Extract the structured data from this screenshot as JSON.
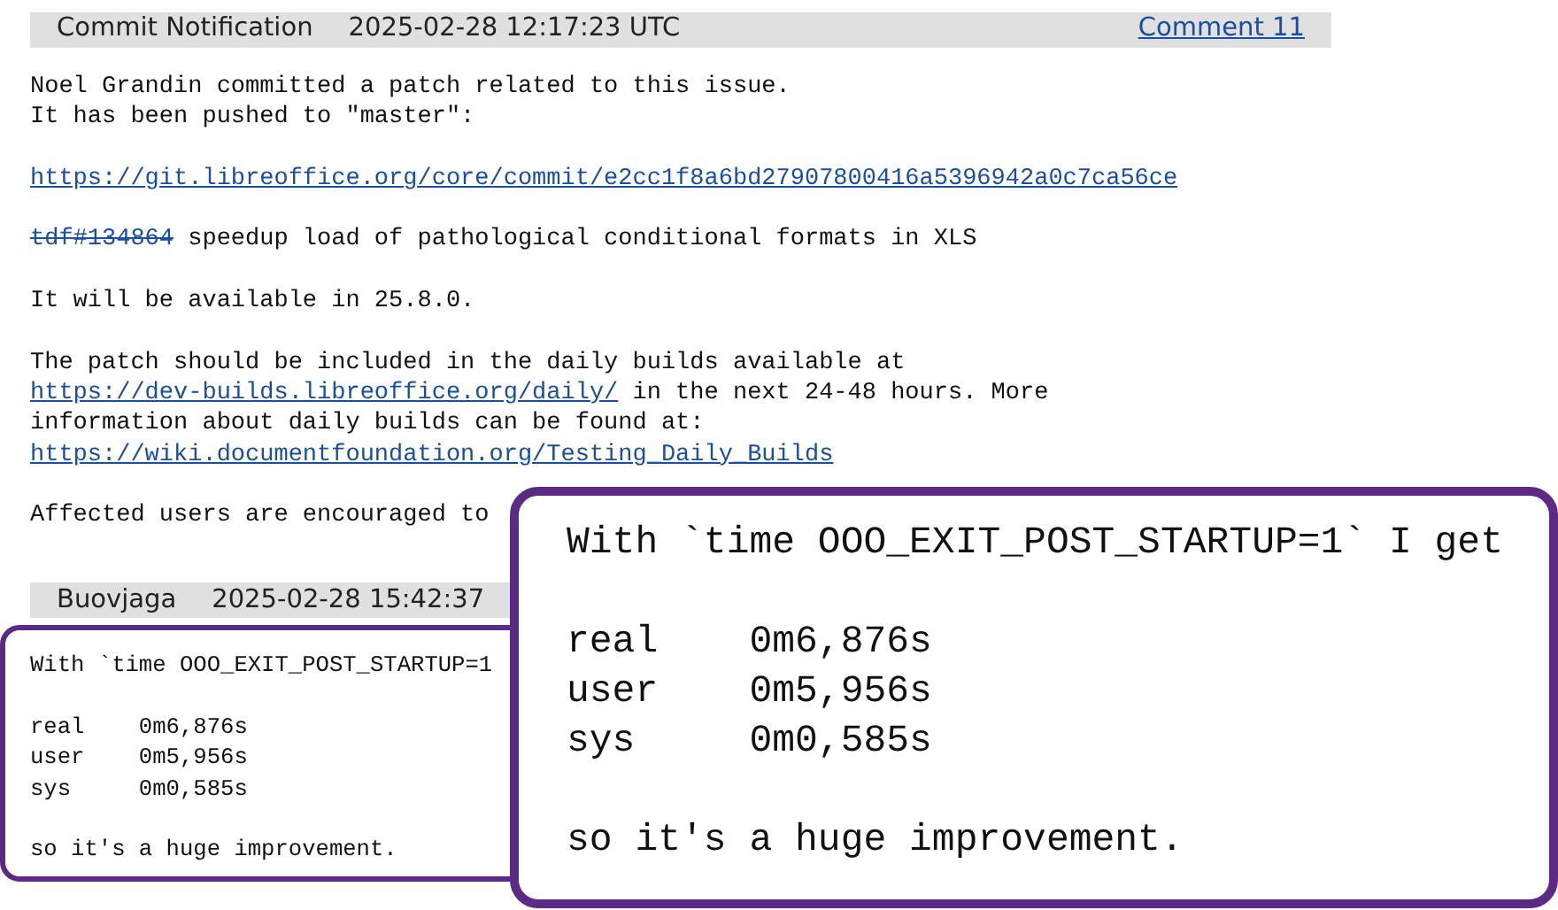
{
  "comments": [
    {
      "author": "Commit Notification",
      "time": "2025-02-28 12:17:23 UTC",
      "link": "Comment 11",
      "boxed": false,
      "blocks": [
        [
          [
            {
              "kind": "text",
              "text": "Noel Grandin committed a patch related to this issue."
            }
          ],
          [
            {
              "kind": "text",
              "text": "It has been pushed to \"master\":"
            }
          ]
        ],
        [
          [
            {
              "kind": "link",
              "text": "https://git.libreoffice.org/core/commit/e2cc1f8a6bd27907800416a5396942a0c7ca56ce"
            }
          ]
        ],
        [
          [
            {
              "kind": "closed_bug",
              "text": "tdf#134864"
            },
            {
              "kind": "text",
              "text": " speedup load of pathological conditional formats in XLS"
            }
          ]
        ],
        [
          [
            {
              "kind": "text",
              "text": "It will be available in 25.8.0."
            }
          ]
        ],
        [
          [
            {
              "kind": "text",
              "text": "The patch should be included in the daily builds available at"
            }
          ],
          [
            {
              "kind": "link",
              "text": "https://dev-builds.libreoffice.org/daily/"
            },
            {
              "kind": "text",
              "text": " in the next 24-48 hours. More"
            }
          ],
          [
            {
              "kind": "text",
              "text": "information about daily builds can be found at:"
            }
          ],
          [
            {
              "kind": "link",
              "text": "https://wiki.documentfoundation.org/Testing_Daily_Builds"
            }
          ]
        ],
        [
          [
            {
              "kind": "text",
              "text": "Affected users are encouraged to"
            }
          ]
        ]
      ]
    },
    {
      "author": "Buovjaga",
      "time": "2025-02-28 15:42:37",
      "boxed": true,
      "blocks": [
        [
          [
            {
              "kind": "text",
              "text": "With `time OOO_EXIT_POST_STARTUP=1"
            }
          ]
        ],
        [
          [
            {
              "kind": "text",
              "text": "real    0m6,876s"
            }
          ],
          [
            {
              "kind": "text",
              "text": "user    0m5,956s"
            }
          ],
          [
            {
              "kind": "text",
              "text": "sys     0m0,585s"
            }
          ]
        ],
        [
          [
            {
              "kind": "text",
              "text": "so it's a huge improvement."
            }
          ]
        ]
      ]
    }
  ],
  "callout": {
    "blocks": [
      [
        "With `time OOO_EXIT_POST_STARTUP=1` I get"
      ],
      [
        "real    0m6,876s",
        "user    0m5,956s",
        "sys     0m0,585s"
      ],
      [
        "so it's a huge improvement."
      ]
    ]
  }
}
